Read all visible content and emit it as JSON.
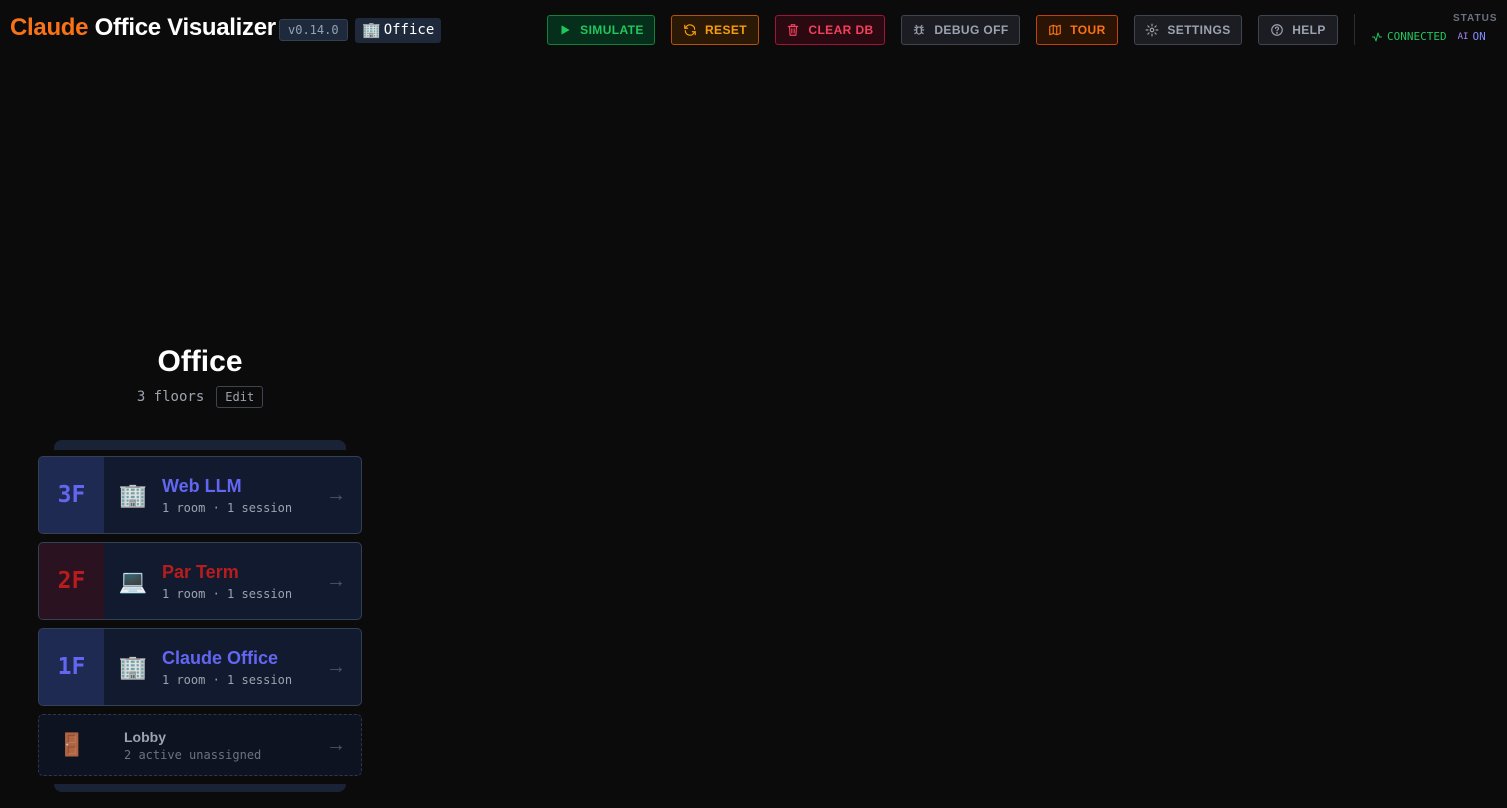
{
  "header": {
    "brand": "Claude",
    "title_rest": "Office Visualizer",
    "version": "v0.14.0",
    "office_icon": "🏢",
    "office_label": "Office"
  },
  "toolbar": {
    "simulate": "SIMULATE",
    "reset": "RESET",
    "clear_db": "CLEAR DB",
    "debug": "DEBUG OFF",
    "tour": "TOUR",
    "settings": "SETTINGS",
    "help": "HELP"
  },
  "status": {
    "label": "STATUS",
    "connection": "CONNECTED",
    "ai_label": "AI",
    "ai_state": "ON"
  },
  "building": {
    "name": "Office",
    "floors_count": "3 floors",
    "edit_label": "Edit",
    "floors": [
      {
        "level": "3F",
        "icon": "🏢",
        "name": "Web LLM",
        "meta": "1 room · 1 session",
        "arrow": "→",
        "color": "#6366f1"
      },
      {
        "level": "2F",
        "icon": "💻",
        "name": "Par Term",
        "meta": "1 room · 1 session",
        "arrow": "→",
        "color": "#b91c1c"
      },
      {
        "level": "1F",
        "icon": "🏢",
        "name": "Claude Office",
        "meta": "1 room · 1 session",
        "arrow": "→",
        "color": "#6366f1"
      }
    ],
    "lobby": {
      "icon": "🚪",
      "name": "Lobby",
      "meta": "2 active unassigned",
      "arrow": "→"
    }
  },
  "icons": [
    "play-icon",
    "refresh-icon",
    "trash-icon",
    "bug-icon",
    "map-icon",
    "gear-icon",
    "help-circle-icon",
    "activity-icon"
  ]
}
